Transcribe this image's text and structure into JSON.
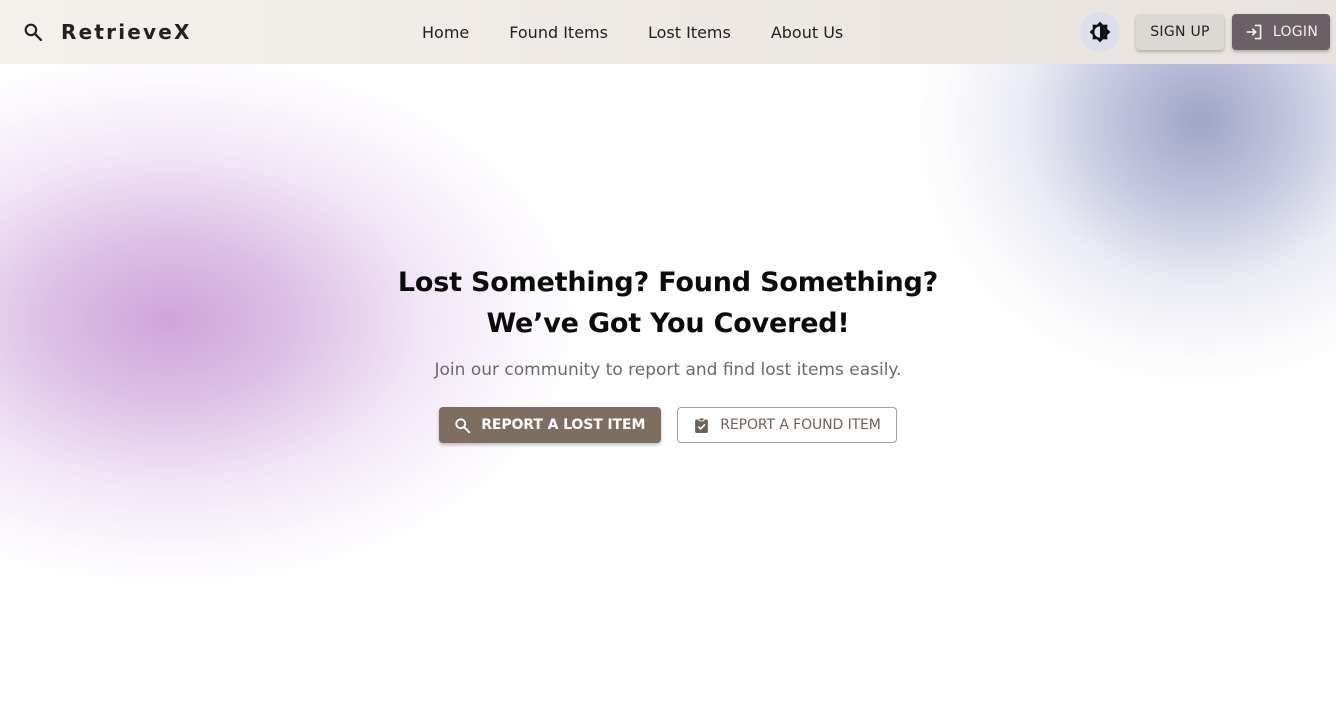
{
  "app": {
    "brand_name": "RetrieveX",
    "brand_icon": "search-icon"
  },
  "nav": {
    "links": [
      {
        "label": "Home"
      },
      {
        "label": "Found Items"
      },
      {
        "label": "Lost Items"
      },
      {
        "label": "About Us"
      }
    ],
    "theme_toggle_icon": "brightness-icon",
    "signup_label": "SIGN UP",
    "login_label": "LOGIN",
    "login_icon": "login-icon"
  },
  "hero": {
    "title_line1": "Lost Something? Found Something?",
    "title_line2": "We’ve Got You Covered!",
    "subtitle": "Join our community to report and find lost items easily.",
    "primary_button": {
      "label": "REPORT A LOST ITEM",
      "icon": "search-icon"
    },
    "secondary_button": {
      "label": "REPORT A FOUND ITEM",
      "icon": "clipboard-check-icon"
    }
  },
  "colors": {
    "navbar_bg": "#efebe7",
    "primary_button": "#7d6e60",
    "login_button": "#6a6066",
    "signup_button": "#dcd8d4",
    "blob_purple": "#d2a8dc",
    "blob_blue": "#a2a6c6"
  }
}
